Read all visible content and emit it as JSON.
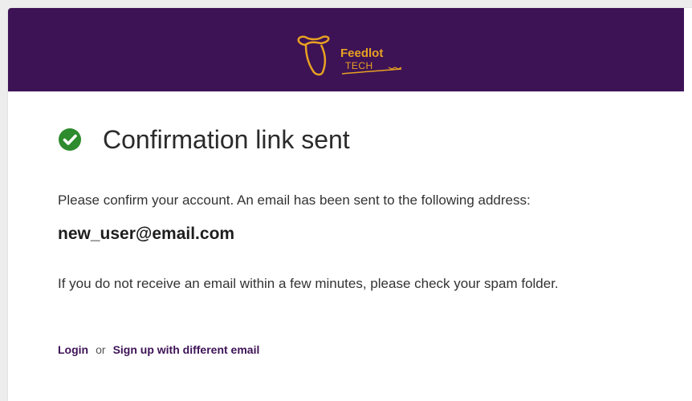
{
  "header": {
    "logo_name": "Feedlot",
    "logo_sub": "TECH",
    "logo_icon": "cow-head-icon",
    "bg_color": "#3d1356",
    "accent_color": "#e8a221"
  },
  "main": {
    "title": "Confirmation link sent",
    "status_icon": "check-circle-icon",
    "status_color": "#2e8b2e",
    "message": "Please confirm your account. An email has been sent to the following address:",
    "email": "new_user@email.com",
    "spam_note": "If you do not receive an email within a few minutes, please check your spam folder."
  },
  "footer_links": {
    "login_label": "Login",
    "or_label": "or",
    "signup_label": "Sign up with different email"
  }
}
